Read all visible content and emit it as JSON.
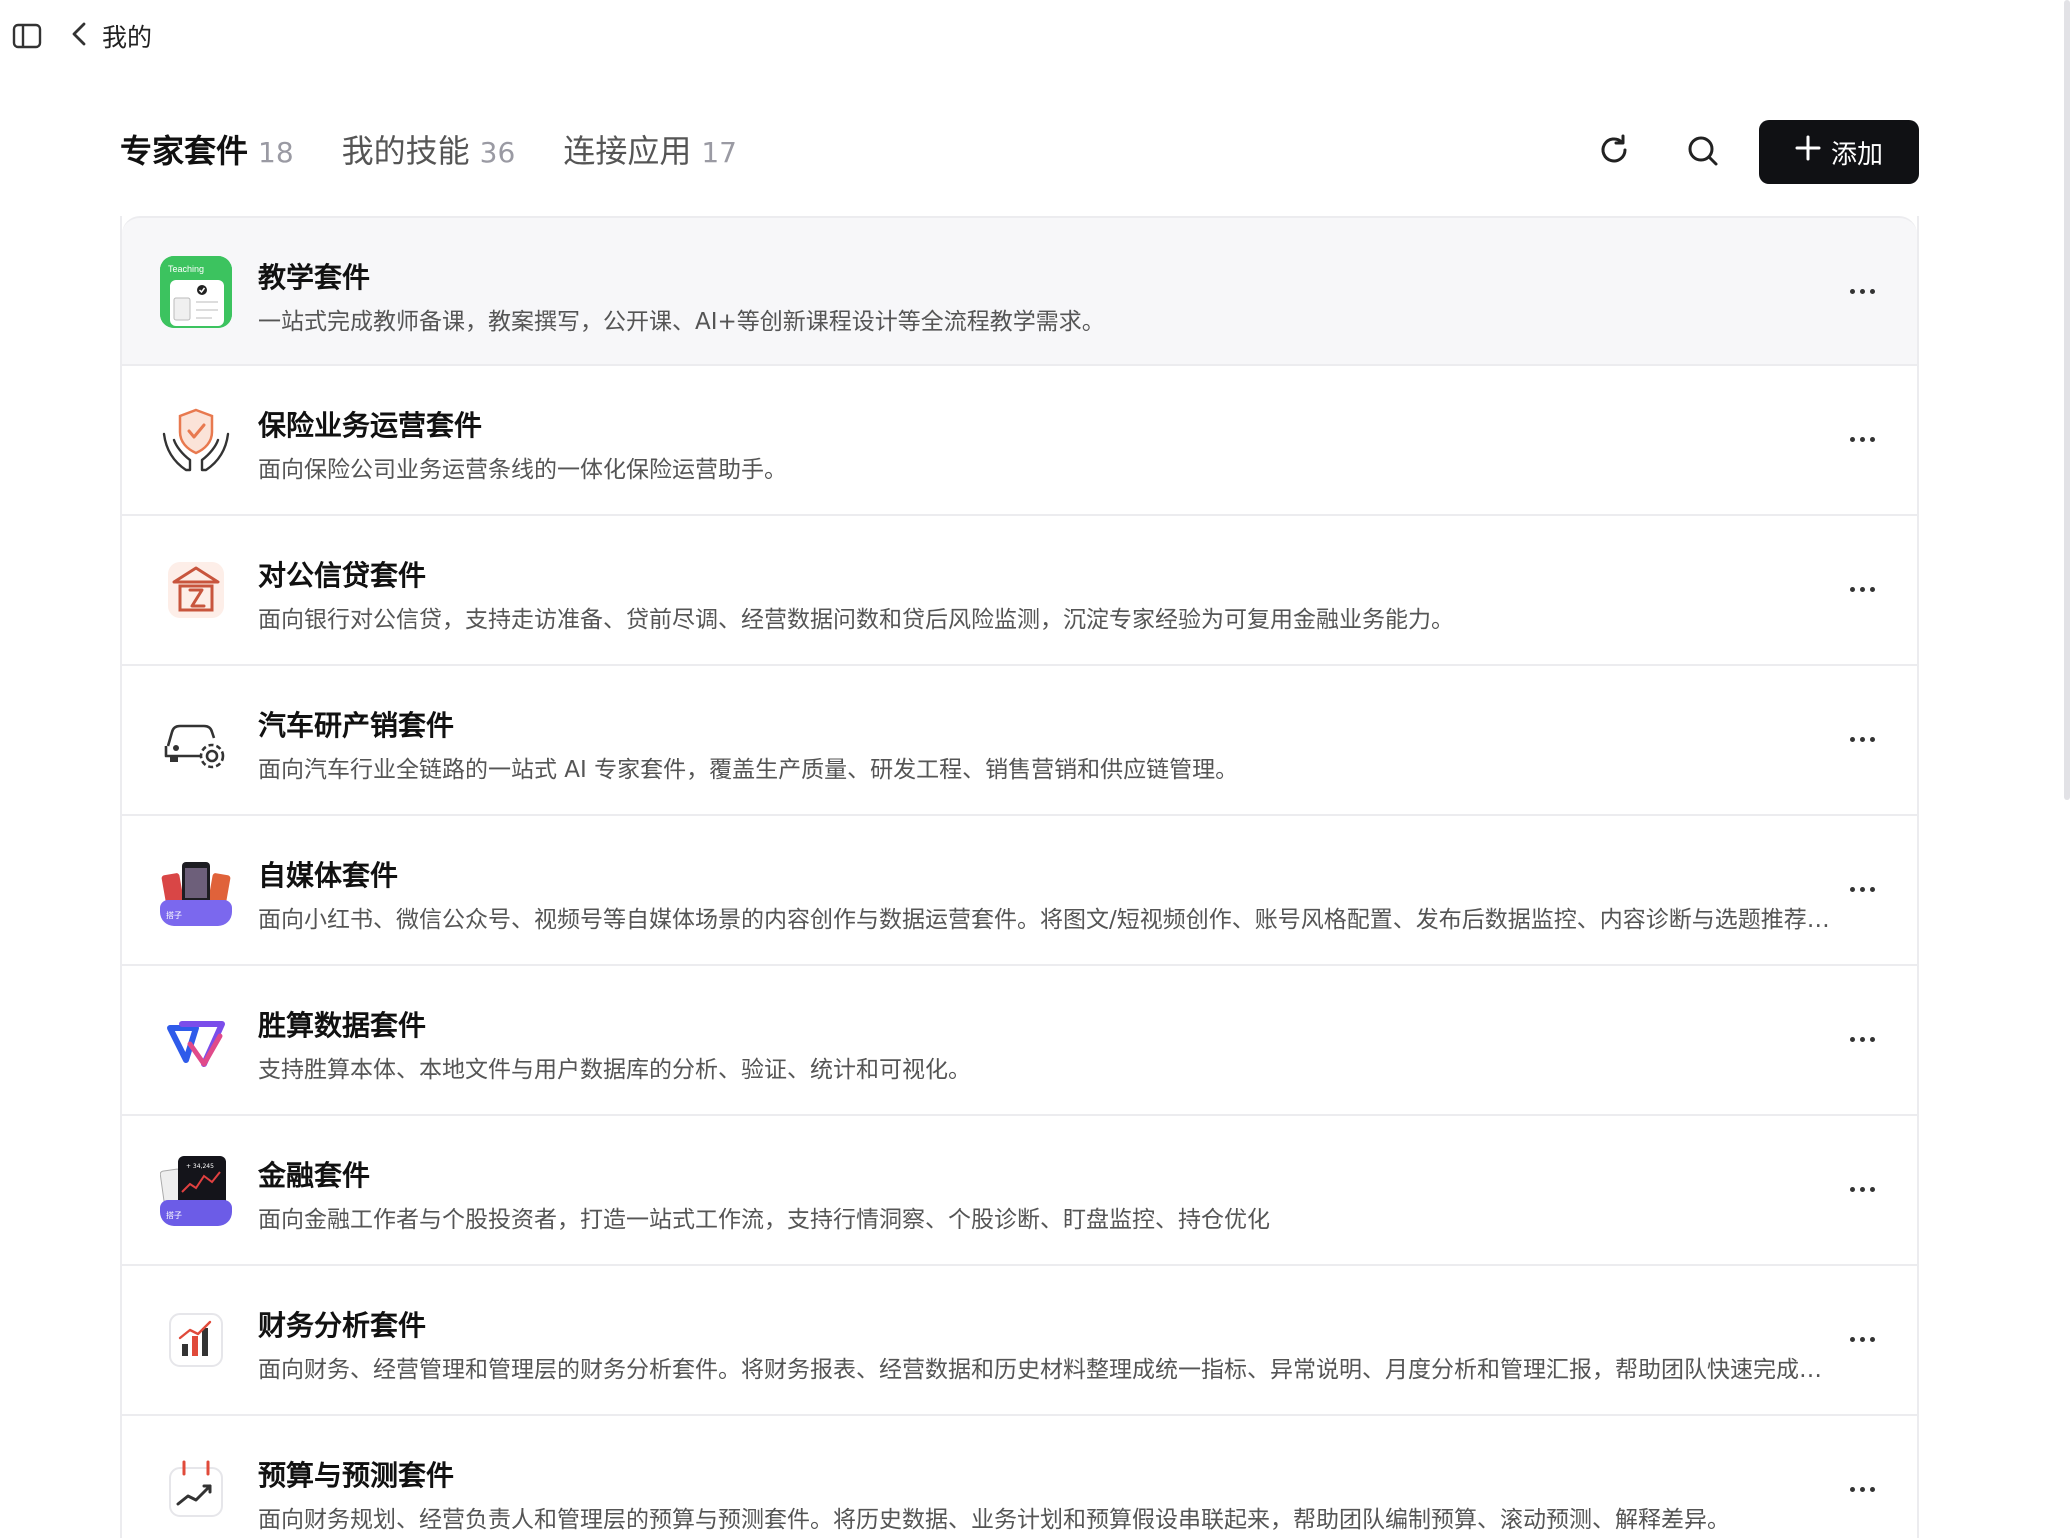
{
  "header": {
    "back_label": "我的"
  },
  "tabs": [
    {
      "label": "专家套件",
      "count": "18",
      "active": true
    },
    {
      "label": "我的技能",
      "count": "36",
      "active": false
    },
    {
      "label": "连接应用",
      "count": "17",
      "active": false
    }
  ],
  "toolbar": {
    "add_label": "添加"
  },
  "suites": [
    {
      "title": "教学套件",
      "desc": "一站式完成教师备课，教案撰写，公开课、AI+等创新课程设计等全流程教学需求。",
      "icon": "teaching-icon",
      "icon_text": "Teaching"
    },
    {
      "title": "保险业务运营套件",
      "desc": "面向保险公司业务运营条线的一体化保险运营助手。",
      "icon": "insurance-shield-hands-icon"
    },
    {
      "title": "对公信贷套件",
      "desc": "面向银行对公信贷，支持走访准备、贷前尽调、经营数据问数和贷后风险监测，沉淀专家经验为可复用金融业务能力。",
      "icon": "bank-building-icon"
    },
    {
      "title": "汽车研产销套件",
      "desc": "面向汽车行业全链路的一站式 AI 专家套件，覆盖生产质量、研发工程、销售营销和供应链管理。",
      "icon": "car-gear-icon"
    },
    {
      "title": "自媒体套件",
      "desc": "面向小红书、微信公众号、视频号等自媒体场景的内容创作与数据运营套件。将图文/短视频创作、账号风格配置、发布后数据监控、内容诊断与选题推荐整合为完整工作流。",
      "icon": "media-phones-icon",
      "icon_text": "搭子"
    },
    {
      "title": "胜算数据套件",
      "desc": "支持胜算本体、本地文件与用户数据库的分析、验证、统计和可视化。",
      "icon": "shengsuan-logo-icon"
    },
    {
      "title": "金融套件",
      "desc": "面向金融工作者与个股投资者，打造一站式工作流，支持行情洞察、个股诊断、盯盘监控、持仓优化",
      "icon": "finance-phone-icon",
      "icon_text": "搭子",
      "icon_ticker": "+ 34,245"
    },
    {
      "title": "财务分析套件",
      "desc": "面向财务、经营管理和管理层的财务分析套件。将财务报表、经营数据和历史材料整理成统一指标、异常说明、月度分析和管理汇报，帮助团队快速完成分析。",
      "icon": "bar-chart-icon"
    },
    {
      "title": "预算与预测套件",
      "desc": "面向财务规划、经营负责人和管理层的预算与预测套件。将历史数据、业务计划和预算假设串联起来，帮助团队编制预算、滚动预测、解释差异。",
      "icon": "calendar-trend-icon"
    }
  ],
  "colors": {
    "accent": "#101114",
    "teaching_green": "#3cc35f",
    "insurance_orange": "#e8794f",
    "bank_red": "#c8553d",
    "media_purple": "#7b68ee",
    "finance_purple": "#6c5ce7"
  }
}
